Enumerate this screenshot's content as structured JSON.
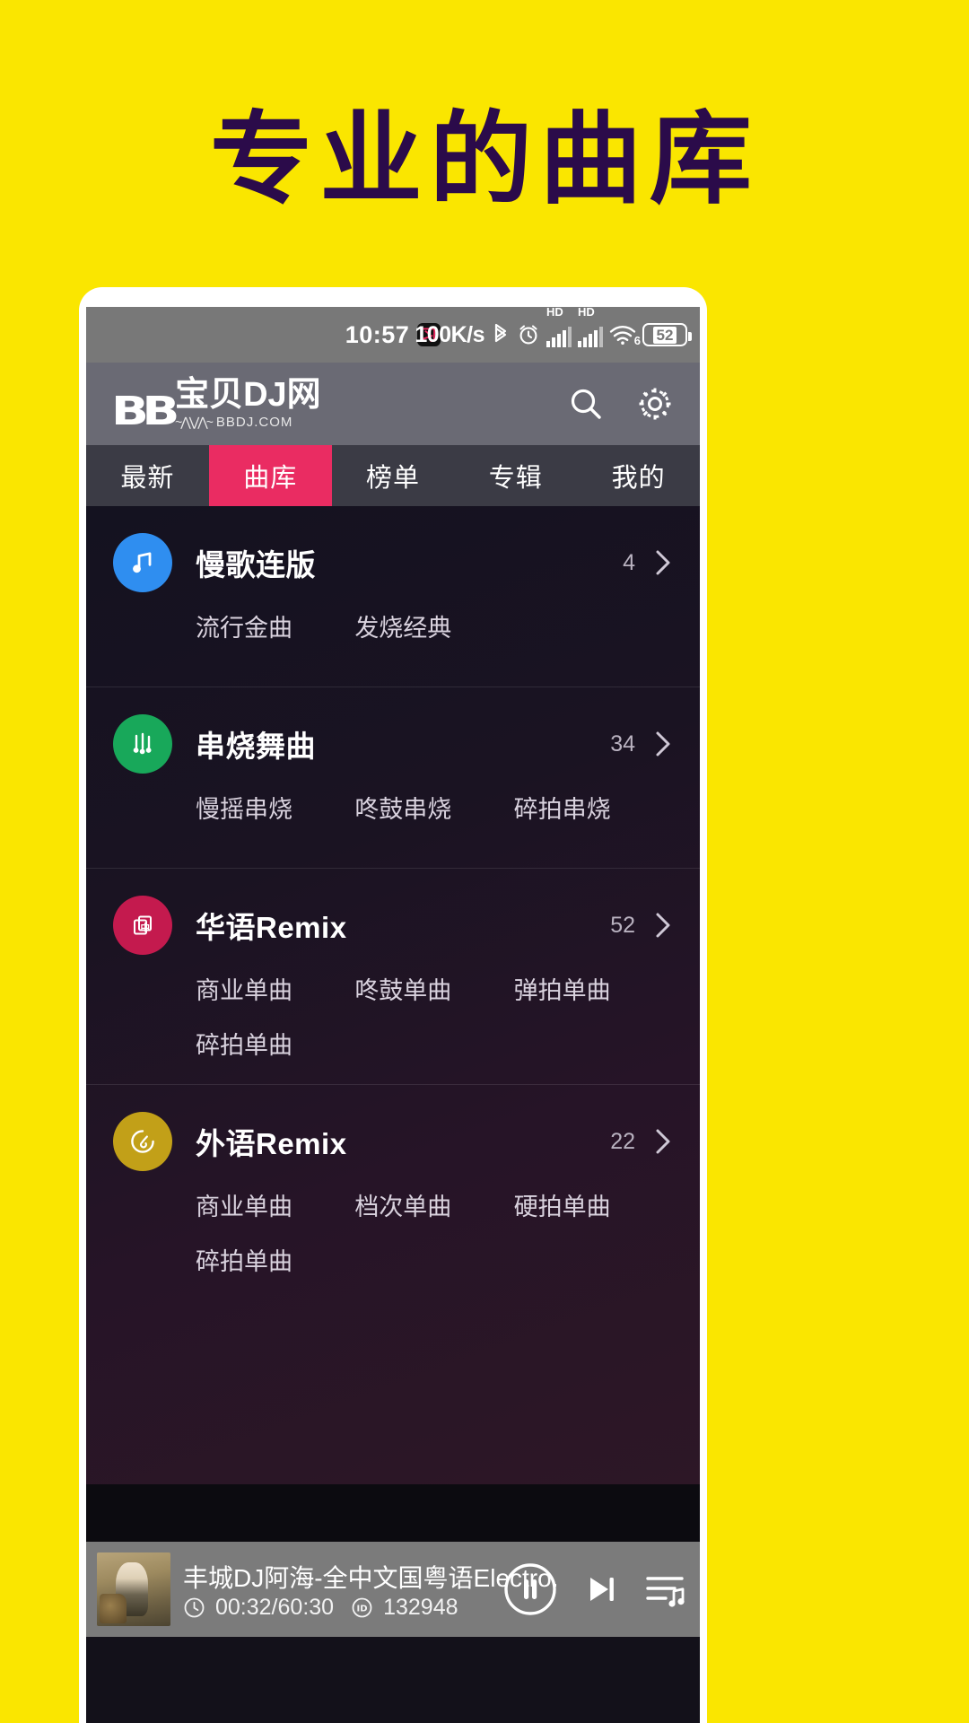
{
  "headline": "专业的曲库",
  "theme": {
    "page_bg": "#FAE600",
    "headline_color": "#2B0B4A",
    "accent_pink": "#EA2C62",
    "statusbar_bg": "#787878",
    "appbar_bg": "#6A6A74",
    "tabbar_bg": "#3B3B45",
    "player_bg": "#7B7B7B"
  },
  "statusbar": {
    "time": "10:57",
    "app_badge_icon": "notification-app-icon",
    "network_speed": "100K/s",
    "bluetooth_icon": "bluetooth-icon",
    "alarm_icon": "alarm-clock-icon",
    "sim1_label": "HD",
    "sim2_label": "HD",
    "wifi_icon": "wifi-icon",
    "wifi_generation": "6",
    "battery_percent": "52"
  },
  "appbar": {
    "logo_mark": "BB",
    "logo_name": "宝贝DJ网",
    "logo_domain": "BBDJ.COM",
    "search_icon": "search-icon",
    "settings_icon": "gear-icon"
  },
  "tabs": [
    {
      "label": "最新",
      "active": false
    },
    {
      "label": "曲库",
      "active": true
    },
    {
      "label": "榜单",
      "active": false
    },
    {
      "label": "专辑",
      "active": false
    },
    {
      "label": "我的",
      "active": false
    }
  ],
  "categories": [
    {
      "title": "慢歌连版",
      "count": "4",
      "icon": "music-note-icon",
      "icon_color": "#2f8ef0",
      "tags": [
        "流行金曲",
        "发烧经典"
      ]
    },
    {
      "title": "串烧舞曲",
      "count": "34",
      "icon": "equalizer-notes-icon",
      "icon_color": "#18a85a",
      "tags": [
        "慢摇串烧",
        "咚鼓串烧",
        "碎拍串烧"
      ]
    },
    {
      "title": "华语Remix",
      "count": "52",
      "icon": "chinese-albums-icon",
      "icon_color": "#c41a4e",
      "tags": [
        "商业单曲",
        "咚鼓单曲",
        "弹拍单曲",
        "碎拍单曲"
      ]
    },
    {
      "title": "外语Remix",
      "count": "22",
      "icon": "vinyl-disc-icon",
      "icon_color": "#c2a018",
      "tags": [
        "商业单曲",
        "档次单曲",
        "硬拍单曲",
        "碎拍单曲"
      ]
    }
  ],
  "chevron": "›",
  "player": {
    "cover_alt": "album-cover",
    "track_title": "丰城DJ阿海-全中文国粤语Electro.",
    "time_icon": "clock-icon",
    "time_text": "00:32/60:30",
    "id_icon": "id-icon",
    "id_text": "132948",
    "pause_icon": "pause-circle-icon",
    "next_icon": "next-track-icon",
    "playlist_icon": "playlist-music-icon"
  }
}
